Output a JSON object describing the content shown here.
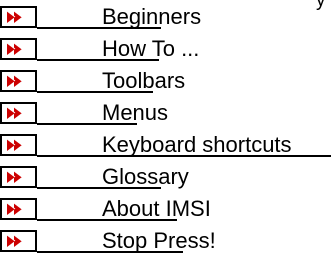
{
  "top_mark": "y",
  "colors": {
    "icon_red": "#cc0000",
    "icon_fill": "#ffffff",
    "icon_gray": "#c0c0c0",
    "text": "#000000"
  },
  "icon_name": "fast-forward-icon",
  "menu": {
    "items": [
      {
        "label": "Beginners"
      },
      {
        "label": "How To ..."
      },
      {
        "label": "Toolbars"
      },
      {
        "label": "Menus"
      },
      {
        "label": "Keyboard shortcuts"
      },
      {
        "label": "Glossary"
      },
      {
        "label": "About IMSI"
      },
      {
        "label": "Stop Press!"
      }
    ]
  }
}
